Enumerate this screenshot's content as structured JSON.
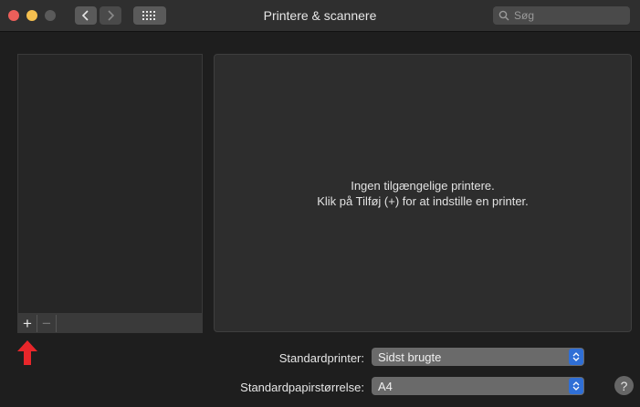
{
  "window": {
    "title": "Printere & scannere"
  },
  "search": {
    "placeholder": "Søg"
  },
  "toolbar": {
    "add_label": "+",
    "remove_label": "−"
  },
  "empty_state": {
    "line1": "Ingen tilgængelige printere.",
    "line2": "Klik på Tilføj (+) for at indstille en printer."
  },
  "settings": {
    "default_printer": {
      "label": "Standardprinter:",
      "value": "Sidst brugte"
    },
    "default_paper_size": {
      "label": "Standardpapirstørrelse:",
      "value": "A4"
    }
  },
  "help": {
    "label": "?"
  },
  "colors": {
    "close": "#ec5f5a",
    "minimize": "#f4bf4f",
    "accent": "#2f6fd6",
    "annotation_arrow": "#e8262a"
  },
  "icons": [
    "back-chevron-icon",
    "forward-chevron-icon",
    "grid-icon",
    "search-icon",
    "stepper-arrows-icon",
    "red-arrow-icon"
  ]
}
